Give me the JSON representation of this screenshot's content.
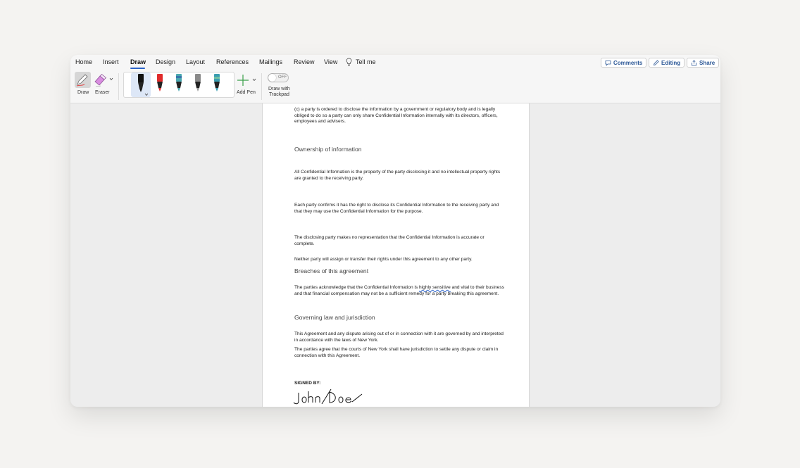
{
  "menu": {
    "tabs": [
      {
        "label": "Home"
      },
      {
        "label": "Insert"
      },
      {
        "label": "Draw",
        "active": true
      },
      {
        "label": "Design"
      },
      {
        "label": "Layout"
      },
      {
        "label": "References"
      },
      {
        "label": "Mailings"
      },
      {
        "label": "Review"
      },
      {
        "label": "View"
      }
    ],
    "tell_me": "Tell me",
    "comments": "Comments",
    "editing": "Editing",
    "share": "Share"
  },
  "ribbon": {
    "draw_label": "Draw",
    "eraser_label": "Eraser",
    "pens": [
      {
        "name": "black-pen",
        "color": "#111111",
        "selected": true
      },
      {
        "name": "red-pen",
        "color": "#e02b2b"
      },
      {
        "name": "galaxy-pen",
        "color": "#4aa8b0"
      },
      {
        "name": "silver-pen",
        "color": "#888888"
      },
      {
        "name": "ocean-pen",
        "color": "#3a9db0"
      }
    ],
    "add_pen": "Add Pen",
    "trackpad_toggle": "OFF",
    "trackpad_label_1": "Draw with",
    "trackpad_label_2": "Trackpad"
  },
  "document": {
    "p1": "(c) a party is ordered to disclose the information by a government or regulatory body and is legally obliged to do so a party can only share Confidential Information internally with its directors, officers, employees and advisers.",
    "h1": "Ownership of information",
    "p2": "All Confidential Information is the property of the party disclosing it and no intellectual property rights are granted to the receiving party.",
    "p3": "Each party confirms it has the right to disclose its Confidential Information to the receiving party and that they may use the Confidential Information for the purpose.",
    "p4": "The disclosing party makes no representation that the Confidential Information is accurate or complete.",
    "p5": "Neither party will assign or transfer their rights under this agreement to any other party.",
    "h2": "Breaches of this agreement",
    "p6_before": "The parties acknowledge that the Confidential Information is ",
    "p6_flagged": "highly sensitive",
    "p6_after": " and vital to their business and that financial compensation may not be a sufficient remedy for a party breaking this agreement.",
    "h3": "Governing law and jurisdiction",
    "p7": "This Agreement and any dispute arising out of or in connection with it are governed by and interpreted in accordance with the laws of New York.",
    "p8": "The parties agree that the courts of New York shall have jurisdiction to settle any dispute or claim in connection with this Agreement.",
    "signed_by": "SIGNED BY:",
    "signature": "John Doe"
  },
  "colors": {
    "accent": "#2a62c9",
    "button_text": "#2b5796"
  }
}
